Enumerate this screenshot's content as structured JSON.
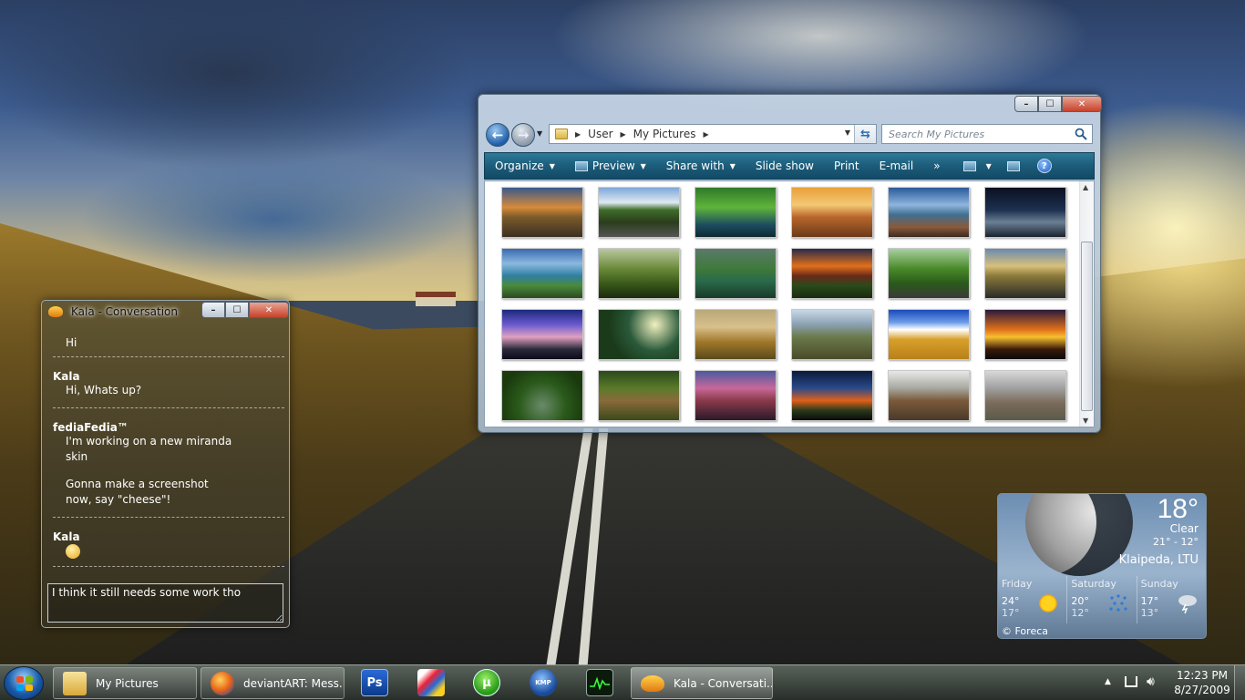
{
  "explorer": {
    "breadcrumb": [
      "User",
      "My Pictures"
    ],
    "search_placeholder": "Search My Pictures",
    "toolbar": [
      "Organize",
      "Preview",
      "Share with",
      "Slide show",
      "Print",
      "E-mail"
    ],
    "overflow": "»",
    "help": "?"
  },
  "chat": {
    "title": "Kala - Conversation",
    "messages": [
      {
        "sender": "",
        "lines": [
          "Hi"
        ]
      },
      {
        "sender": "Kala",
        "lines": [
          "Hi, Whats up?"
        ]
      },
      {
        "sender": "fediaFedia™",
        "lines": [
          "I'm working on a new miranda",
          "skin",
          "",
          "Gonna make a screenshot",
          "now, say \"cheese\"!"
        ]
      },
      {
        "sender": "Kala",
        "lines": []
      }
    ],
    "input_value": "I think it still needs some work tho"
  },
  "weather": {
    "temp": "18°",
    "condition": "Clear",
    "range": "21°  -  12°",
    "city": "Klaipeda, LTU",
    "forecast": [
      {
        "day": "Friday",
        "hi": "24°",
        "lo": "17°",
        "icon": "sun-icon"
      },
      {
        "day": "Saturday",
        "hi": "20°",
        "lo": "12°",
        "icon": "rain-icon"
      },
      {
        "day": "Sunday",
        "hi": "17°",
        "lo": "13°",
        "icon": "storm-icon"
      }
    ],
    "credit": "© Foreca"
  },
  "taskbar": {
    "tasks": [
      "My Pictures",
      "deviantART: Mess...",
      "Kala - Conversati..."
    ],
    "pinned": [
      "photoshop-icon",
      "paint-icon",
      "utorrent-icon",
      "kmplayer-icon",
      "monitor-icon"
    ],
    "photoshop_label": "Ps",
    "utorrent_label": "µ",
    "kmp_label": "KMP",
    "time": "12:23 PM",
    "date": "8/27/2009"
  },
  "colors": {
    "toolbar": "#1c5c7a",
    "accent": "#1e5fa8"
  }
}
